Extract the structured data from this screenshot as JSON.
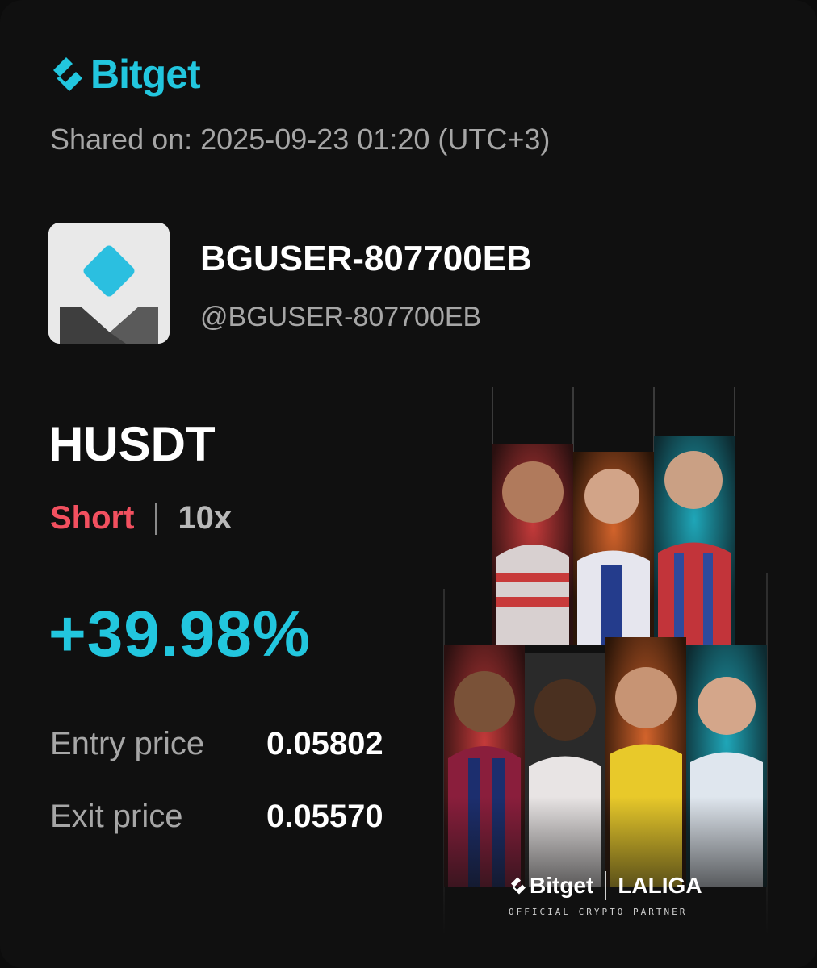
{
  "brand": {
    "name": "Bitget",
    "accent_color": "#22c6de"
  },
  "shared": {
    "text": "Shared on: 2025-09-23 01:20 (UTC+3)"
  },
  "user": {
    "display_name": "BGUSER-807700EB",
    "handle": "@BGUSER-807700EB",
    "avatar_icon": "default-avatar-icon"
  },
  "trade": {
    "pair": "HUSDT",
    "side": "Short",
    "side_color": "#f2505f",
    "leverage": "10x",
    "pnl_percent": "+39.98%",
    "pnl_color": "#22c6de",
    "entry_label": "Entry price",
    "entry_value": "0.05802",
    "exit_label": "Exit price",
    "exit_value": "0.05570"
  },
  "promo": {
    "brand": "Bitget",
    "partner": "LALIGA",
    "tagline": "OFFICIAL CRYPTO PARTNER"
  }
}
